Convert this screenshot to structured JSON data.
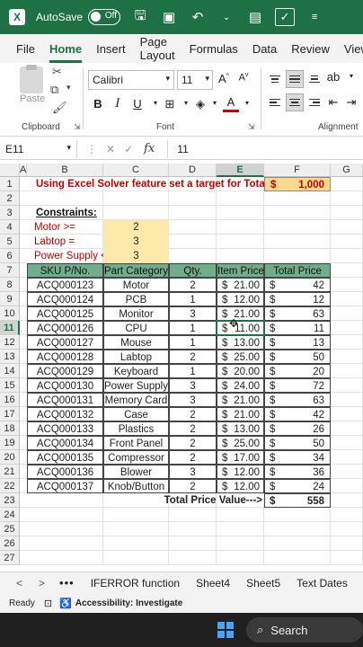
{
  "titlebar": {
    "app_icon": "X",
    "autosave_label": "AutoSave",
    "autosave_state": "Off",
    "icons": [
      "save-icon",
      "print-preview-icon",
      "undo-icon",
      "redo-icon",
      "file-icon",
      "checkbox-icon",
      "more-icon"
    ]
  },
  "tabs": [
    "File",
    "Home",
    "Insert",
    "Page Layout",
    "Formulas",
    "Data",
    "Review",
    "View"
  ],
  "ribbon": {
    "paste_label": "Paste",
    "clipboard_label": "Clipboard",
    "font_name": "Calibri",
    "font_size": "11",
    "font_label": "Font",
    "alignment_label": "Alignment"
  },
  "formula_bar": {
    "name_box": "E11",
    "fx": "fx",
    "value": "11"
  },
  "columns": [
    "A",
    "B",
    "C",
    "D",
    "E",
    "F",
    "G"
  ],
  "rows": [
    "1",
    "2",
    "3",
    "4",
    "5",
    "6",
    "7",
    "8",
    "9",
    "10",
    "11",
    "12",
    "13",
    "14",
    "15",
    "16",
    "17",
    "18",
    "19",
    "20",
    "21",
    "22",
    "23",
    "24",
    "25",
    "26",
    "27"
  ],
  "sheet": {
    "title": "Using Excel Solver feature set a target for Total Price",
    "target_currency": "$",
    "target_value": "1,000",
    "constraints_label": "Constraints:",
    "constraints": [
      {
        "label": "Motor >=",
        "value": "2"
      },
      {
        "label": "Labtop =",
        "value": "3"
      },
      {
        "label": "Power Supply <=",
        "value": "3"
      }
    ],
    "table_headers": [
      "SKU P/No.",
      "Part Category",
      "Qty.",
      "Item Price",
      "Total Price"
    ],
    "table_rows": [
      {
        "sku": "ACQ000123",
        "cat": "Motor",
        "qty": "2",
        "price": "21.00",
        "total": "42"
      },
      {
        "sku": "ACQ000124",
        "cat": "PCB",
        "qty": "1",
        "price": "12.00",
        "total": "12"
      },
      {
        "sku": "ACQ000125",
        "cat": "Monitor",
        "qty": "3",
        "price": "21.00",
        "total": "63"
      },
      {
        "sku": "ACQ000126",
        "cat": "CPU",
        "qty": "1",
        "price": "11.00",
        "total": "11"
      },
      {
        "sku": "ACQ000127",
        "cat": "Mouse",
        "qty": "1",
        "price": "13.00",
        "total": "13"
      },
      {
        "sku": "ACQ000128",
        "cat": "Labtop",
        "qty": "2",
        "price": "25.00",
        "total": "50"
      },
      {
        "sku": "ACQ000129",
        "cat": "Keyboard",
        "qty": "1",
        "price": "20.00",
        "total": "20"
      },
      {
        "sku": "ACQ000130",
        "cat": "Power Supply",
        "qty": "3",
        "price": "24.00",
        "total": "72"
      },
      {
        "sku": "ACQ000131",
        "cat": "Memory Card",
        "qty": "3",
        "price": "21.00",
        "total": "63"
      },
      {
        "sku": "ACQ000132",
        "cat": "Case",
        "qty": "2",
        "price": "21.00",
        "total": "42"
      },
      {
        "sku": "ACQ000133",
        "cat": "Plastics",
        "qty": "2",
        "price": "13.00",
        "total": "26"
      },
      {
        "sku": "ACQ000134",
        "cat": "Front Panel",
        "qty": "2",
        "price": "25.00",
        "total": "50"
      },
      {
        "sku": "ACQ000135",
        "cat": "Compressor",
        "qty": "2",
        "price": "17.00",
        "total": "34"
      },
      {
        "sku": "ACQ000136",
        "cat": "Blower",
        "qty": "3",
        "price": "12.00",
        "total": "36"
      },
      {
        "sku": "ACQ000137",
        "cat": "Knob/Button",
        "qty": "2",
        "price": "12.00",
        "total": "24"
      }
    ],
    "currency": "$",
    "total_label": "Total Price Value--->",
    "total_value": "558"
  },
  "sheet_tabs": {
    "nav_prev": "<",
    "nav_next": ">",
    "more": "•••",
    "tabs": [
      "IFERROR function",
      "Sheet4",
      "Sheet5",
      "Text Dates"
    ]
  },
  "statusbar": {
    "ready": "Ready",
    "accessibility": "Accessibility: Investigate"
  },
  "taskbar": {
    "search_label": "Search"
  },
  "colors": {
    "excel_green": "#1e7145",
    "header_green": "#70ad8d",
    "input_yellow": "#fde9a9",
    "title_red": "#c00000"
  }
}
